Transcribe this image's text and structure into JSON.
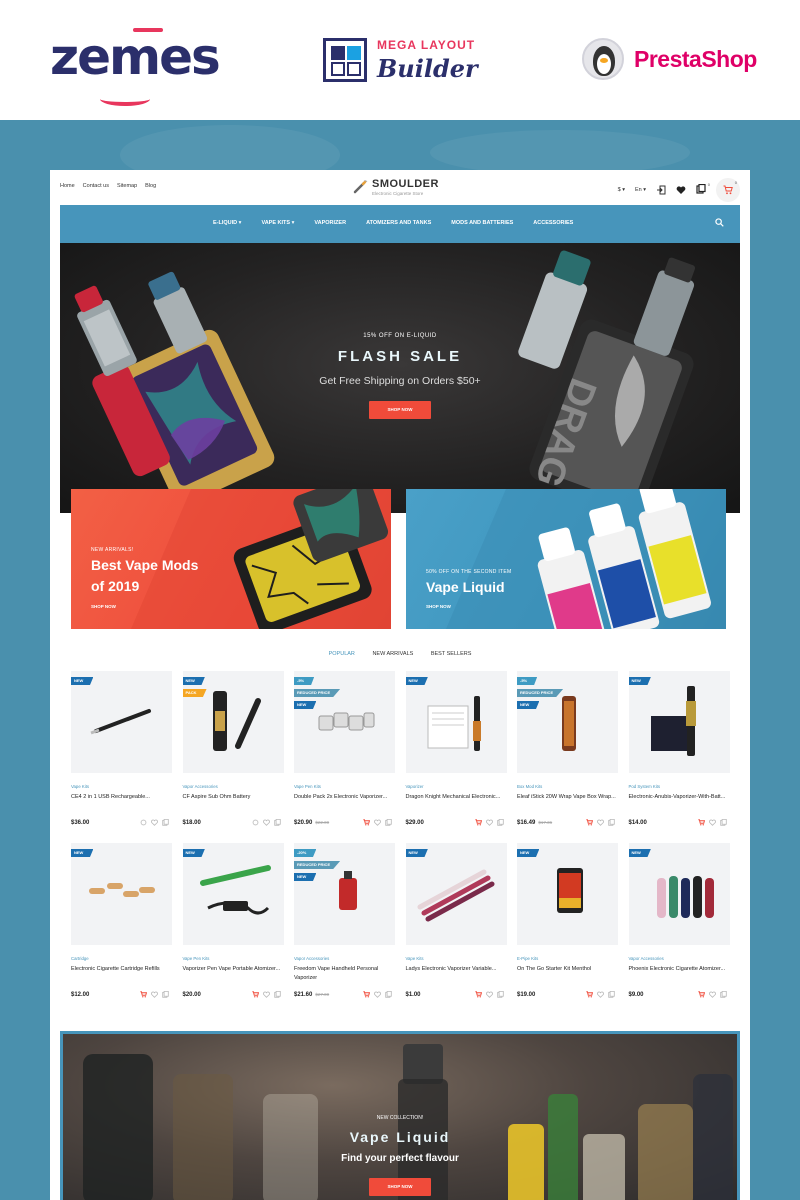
{
  "promo_bar": {
    "zemes": "zemes",
    "mlb_line1": "MEGA LAYOUT",
    "mlb_line2": "Builder",
    "prestashop": "PrestaShop"
  },
  "header": {
    "links": [
      "Home",
      "Contact us",
      "Sitemap",
      "Blog"
    ],
    "brand_name": "SMOULDER",
    "brand_tagline": "Electronic Cigarette Store",
    "currency": "$",
    "language": "En",
    "compare_count": "0",
    "cart_count": "0"
  },
  "nav": {
    "items": [
      "E-LIQUID",
      "VAPE KITS",
      "VAPORIZER",
      "ATOMIZERS AND TANKS",
      "MODS AND BATTERIES",
      "ACCESSORIES"
    ]
  },
  "hero": {
    "kicker": "15% OFF ON E-LIQUID",
    "title": "FLASH SALE",
    "subtitle": "Get Free Shipping on Orders $50+",
    "button": "SHOP NOW"
  },
  "banners": [
    {
      "kicker": "NEW ARRIVALS!",
      "title_line1": "Best Vape Mods",
      "title_line2": "of 2019",
      "link": "SHOP NOW"
    },
    {
      "kicker": "50% OFF ON THE SECOND ITEM",
      "title": "Vape Liquid",
      "link": "SHOP NOW"
    }
  ],
  "tabs": [
    "POPULAR",
    "NEW ARRIVALS",
    "BEST SELLERS"
  ],
  "products": [
    {
      "badges": [
        "NEW"
      ],
      "category": "Vape Kits",
      "name": "CE4 2 in 1 USB Rechargeable...",
      "price": "$36.00",
      "old_price": ""
    },
    {
      "badges": [
        "NEW",
        "PACK"
      ],
      "category": "Vapor Accessories",
      "name": "CF Aspire Sub Ohm Battery",
      "price": "$18.00",
      "old_price": ""
    },
    {
      "badges": [
        "-5%",
        "REDUCED PRICE",
        "NEW"
      ],
      "category": "Vape Pen Kits",
      "name": "Double Pack 2x Electronic Vaporizer...",
      "price": "$20.90",
      "old_price": "$22.00"
    },
    {
      "badges": [
        "NEW"
      ],
      "category": "Vaporizer",
      "name": "Dragon Knight Mechanical Electronic...",
      "price": "$29.00",
      "old_price": ""
    },
    {
      "badges": [
        "-5%",
        "REDUCED PRICE",
        "NEW"
      ],
      "category": "Box Mod Kits",
      "name": "Eleaf iStick 20W Wrap Vape Box Wrap...",
      "price": "$16.49",
      "old_price": "$17.36"
    },
    {
      "badges": [
        "NEW"
      ],
      "category": "Pod System Kits",
      "name": "Electronic-Anubis-Vaporizer-With-Batt...",
      "price": "$14.00",
      "old_price": ""
    },
    {
      "badges": [
        "NEW"
      ],
      "category": "Cartridge",
      "name": "Electronic Cigarette Cartridge Refills",
      "price": "$12.00",
      "old_price": ""
    },
    {
      "badges": [
        "NEW"
      ],
      "category": "Vape Pen Kits",
      "name": "Vaporizer Pen Vape Portable Atomizer...",
      "price": "$20.00",
      "old_price": ""
    },
    {
      "badges": [
        "-20%",
        "REDUCED PRICE",
        "NEW"
      ],
      "category": "Vapor Accessories",
      "name": "Freedom Vape Handheld Personal Vaporizer",
      "price": "$21.60",
      "old_price": "$27.00"
    },
    {
      "badges": [
        "NEW"
      ],
      "category": "Vape Kits",
      "name": "Ladys Electronic Vaporizer Variable...",
      "price": "$1.00",
      "old_price": ""
    },
    {
      "badges": [
        "NEW"
      ],
      "category": "E-Pipe Kits",
      "name": "On The Go Starter Kit Menthol",
      "price": "$19.00",
      "old_price": ""
    },
    {
      "badges": [
        "NEW"
      ],
      "category": "Vapor Accessories",
      "name": "Phoenix Electronic Cigarette Atomizer...",
      "price": "$9.00",
      "old_price": ""
    }
  ],
  "bottom_banner": {
    "kicker": "NEW COLLECTION!",
    "title": "Vape Liquid",
    "subtitle": "Find your perfect flavour",
    "button": "SHOP NOW"
  },
  "colors": {
    "page_bg": "#4a90ad",
    "nav_blue": "#4795bb",
    "accent_red": "#f04b3a",
    "zemes_navy": "#2b2f6b",
    "zemes_pink": "#e8365d",
    "prestashop_pink": "#df0067"
  },
  "icons": {
    "search": "search-icon",
    "login": "login-icon",
    "wishlist": "heart-icon",
    "compare": "compare-icon",
    "cart": "cart-icon"
  }
}
